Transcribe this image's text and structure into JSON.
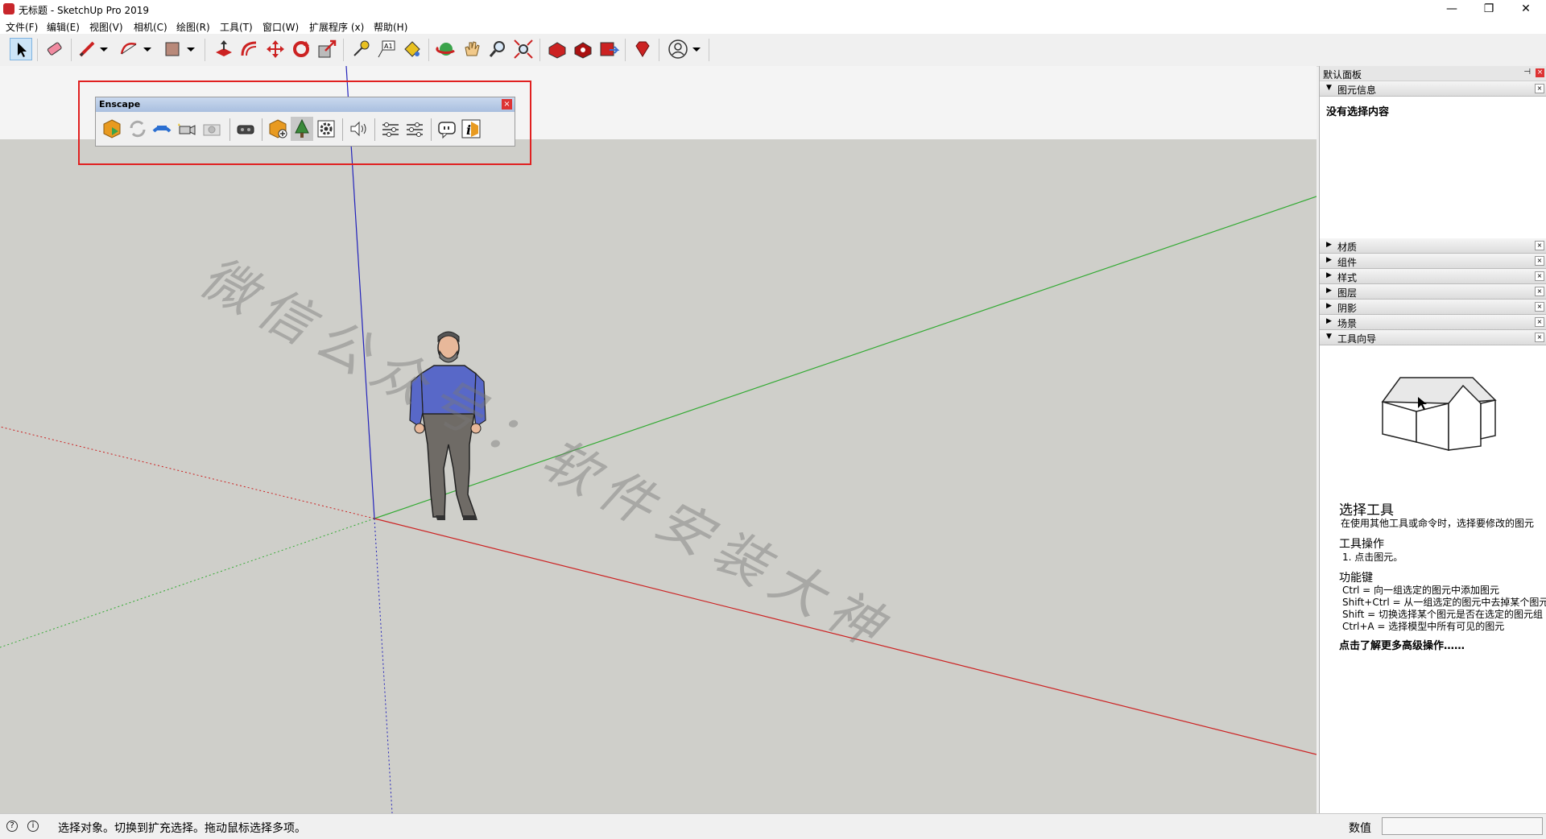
{
  "window": {
    "title": "无标题 - SketchUp Pro 2019",
    "minimize": "—",
    "restore": "❐",
    "close": "✕"
  },
  "menu": [
    "文件(F)",
    "编辑(E)",
    "视图(V)",
    "相机(C)",
    "绘图(R)",
    "工具(T)",
    "窗口(W)",
    "扩展程序 (x)",
    "帮助(H)"
  ],
  "enscape": {
    "title": "Enscape",
    "close": "×"
  },
  "watermark": "微信公众号：软件安装大神",
  "tray": {
    "title": "默认面板",
    "pin": "⊣",
    "close": "×",
    "entity_info": {
      "label": "图元信息",
      "content": "没有选择内容"
    },
    "panels": [
      "材质",
      "组件",
      "样式",
      "图层",
      "阴影",
      "场景",
      "工具向导"
    ],
    "instructor": {
      "title": "选择工具",
      "description": "在使用其他工具或命令时，选择要修改的图元",
      "ops_heading": "工具操作",
      "ops": [
        "1. 点击图元。"
      ],
      "keys_heading": "功能键",
      "keys": [
        "Ctrl = 向一组选定的图元中添加图元",
        "Shift+Ctrl = 从一组选定的图元中去掉某个图元",
        "Shift = 切换选择某个图元是否在选定的图元组",
        "Ctrl+A = 选择模型中所有可见的图元"
      ],
      "more_link": "点击了解更多高级操作……"
    }
  },
  "status": {
    "text": "选择对象。切换到扩充选择。拖动鼠标选择多项。",
    "vcb_label": "数值",
    "info_icon": "i",
    "help_icon": "?"
  },
  "colors": {
    "accent": "#e02020",
    "axis_red": "#cc2222",
    "axis_green": "#33aa33",
    "axis_blue": "#2222bb",
    "ground": "#cfcfca",
    "sky": "#f4f4f4"
  }
}
